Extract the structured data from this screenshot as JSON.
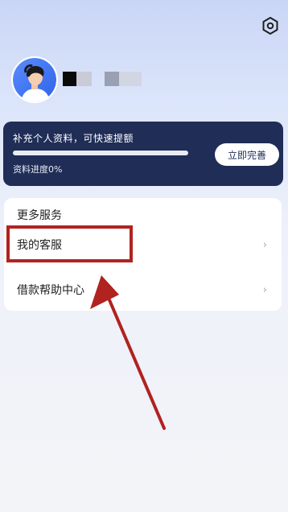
{
  "settings": {
    "icon": "settings-hexagon-icon"
  },
  "user": {
    "avatar": "user-avatar"
  },
  "profile_card": {
    "title": "补充个人资料，可快速提额",
    "progress_text": "资料进度0%",
    "progress_fraction": 0,
    "button_label": "立即完善"
  },
  "services": {
    "title": "更多服务",
    "items": [
      {
        "label": "我的客服",
        "chevron": "›"
      },
      {
        "label": "借款帮助中心",
        "chevron": "›"
      }
    ]
  },
  "colors": {
    "card_bg": "#1f2d57",
    "annotation": "#b0231f"
  }
}
